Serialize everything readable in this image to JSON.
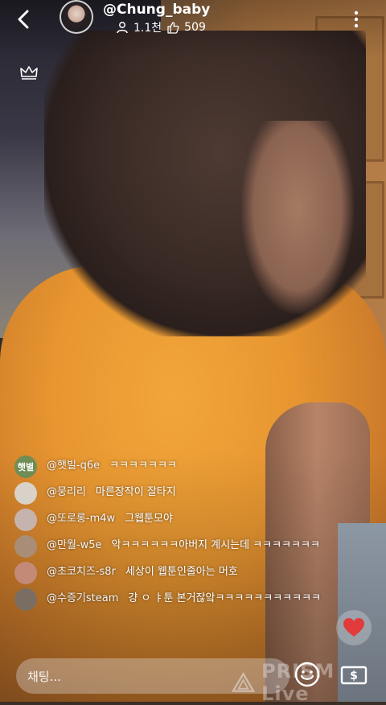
{
  "header": {
    "username": "@Chung_baby",
    "followers": "1.1천",
    "likes": "509",
    "icons": [
      "back-chevron-icon",
      "person-icon",
      "thumbs-up-icon",
      "more-vertical-icon",
      "crown-icon"
    ]
  },
  "chat": {
    "messages": [
      {
        "nick": "@햇빌-q6e",
        "text": "ㅋㅋㅋㅋㅋㅋㅋ",
        "avatar_label": "햇별",
        "avatar_color": "#6f8d55"
      },
      {
        "nick": "@뭉리리",
        "text": "마른장작이 잘타지",
        "avatar_label": "",
        "avatar_color": "#d9d2c8"
      },
      {
        "nick": "@또로롱-m4w",
        "text": "그웹툰모야",
        "avatar_label": "",
        "avatar_color": "#c7b3ad"
      },
      {
        "nick": "@만월-w5e",
        "text": "악ㅋㅋㅋㅋㅋㅋ아버지 계시는데 ㅋㅋㅋㅋㅋㅋㅋ",
        "avatar_label": "",
        "avatar_color": "#a98d76"
      },
      {
        "nick": "@초코치즈-s8r",
        "text": "세상이 웹툰인줄아는 머호",
        "avatar_label": "",
        "avatar_color": "#c48a78"
      },
      {
        "nick": "@수증기steam",
        "text": "걍 ㅇ ㅑ툰 본거잖앜ㅋㅋㅋㅋㅋㅋㅋㅋㅋㅋㅋ",
        "avatar_label": "",
        "avatar_color": "#7a6e62"
      }
    ]
  },
  "input": {
    "placeholder": "채팅..."
  },
  "watermark": {
    "text": "PRISM Live"
  },
  "colors": {
    "heart": "#e23b3b",
    "shirt": "#e89630"
  }
}
